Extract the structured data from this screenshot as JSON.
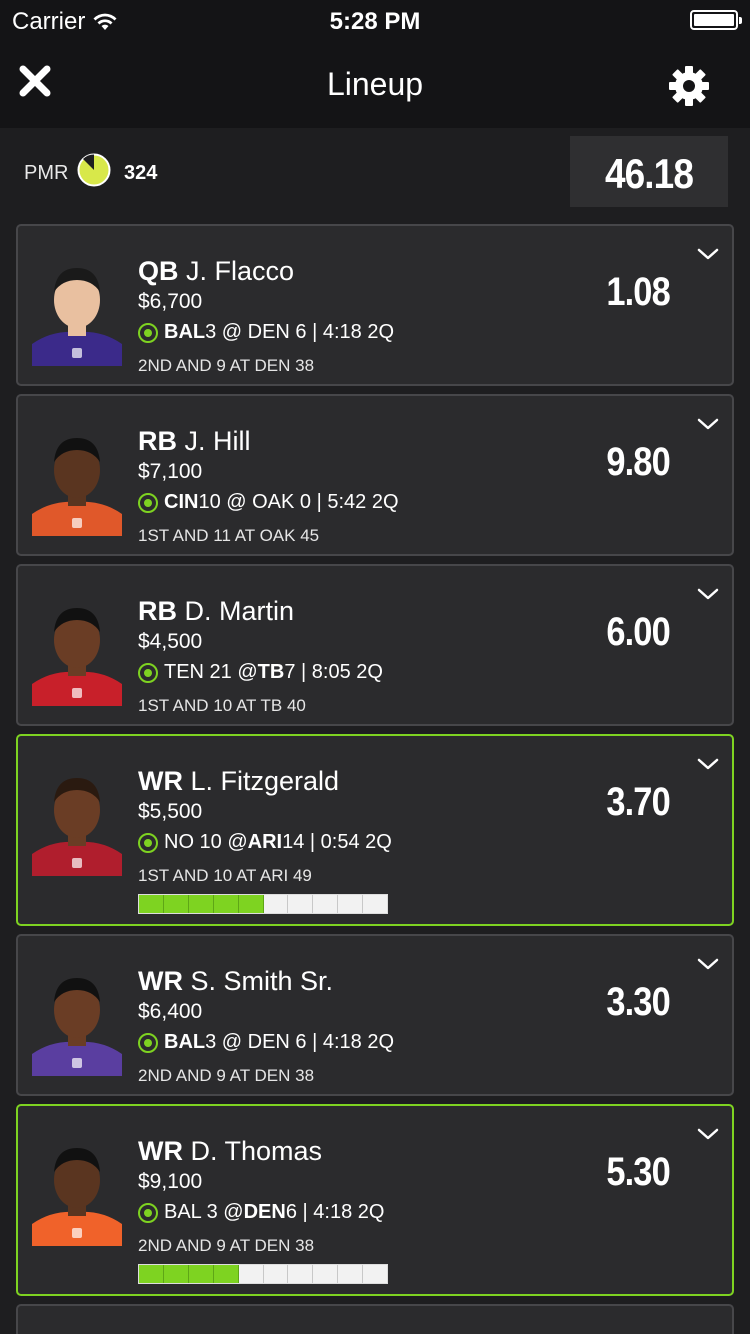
{
  "status_bar": {
    "carrier": "Carrier",
    "time": "5:28 PM"
  },
  "nav": {
    "title": "Lineup"
  },
  "summary": {
    "pmr_label": "PMR",
    "pmr_value": "324",
    "total_points": "46.18"
  },
  "colors": {
    "accent": "#7ed321",
    "background": "#1e1e20",
    "card": "#2b2b2d",
    "header": "#141416"
  },
  "players": [
    {
      "position": "QB",
      "name": "J. Flacco",
      "salary": "$6,700",
      "game_pre": "",
      "game_bold": "BAL",
      "game_mid": " 3 @ DEN 6 | 4:18 2Q",
      "situation": "2ND AND 9 AT DEN 38",
      "points": "1.08",
      "jersey": "#3b2a8a",
      "skin": "#e9c0a0",
      "hair": "#1a1a1a",
      "progress": null
    },
    {
      "position": "RB",
      "name": "J. Hill",
      "salary": "$7,100",
      "game_pre": "",
      "game_bold": "CIN",
      "game_mid": " 10 @ OAK 0 | 5:42 2Q",
      "situation": "1ST AND 11 AT OAK 45",
      "points": "9.80",
      "jersey": "#e0582a",
      "skin": "#5a3520",
      "hair": "#111111",
      "progress": null
    },
    {
      "position": "RB",
      "name": "D. Martin",
      "salary": "$4,500",
      "game_pre": "TEN 21 @ ",
      "game_bold": "TB",
      "game_mid": " 7 | 8:05 2Q",
      "situation": "1ST AND 10 AT TB 40",
      "points": "6.00",
      "jersey": "#c8202a",
      "skin": "#6a3d25",
      "hair": "#111111",
      "progress": null
    },
    {
      "position": "WR",
      "name": "L. Fitzgerald",
      "salary": "$5,500",
      "game_pre": "NO 10 @ ",
      "game_bold": "ARI",
      "game_mid": " 14 | 0:54 2Q",
      "situation": "1ST AND 10 AT ARI 49",
      "points": "3.70",
      "jersey": "#b01e2d",
      "skin": "#6a3d25",
      "hair": "#2a1a10",
      "active": true,
      "progress": {
        "filled": 5,
        "total": 10
      }
    },
    {
      "position": "WR",
      "name": "S. Smith Sr.",
      "salary": "$6,400",
      "game_pre": "",
      "game_bold": "BAL",
      "game_mid": " 3 @ DEN 6 | 4:18 2Q",
      "situation": "2ND AND 9 AT DEN 38",
      "points": "3.30",
      "jersey": "#5a3ea0",
      "skin": "#6a3d25",
      "hair": "#111111",
      "progress": null
    },
    {
      "position": "WR",
      "name": "D. Thomas",
      "salary": "$9,100",
      "game_pre": "BAL 3 @ ",
      "game_bold": "DEN",
      "game_mid": " 6 | 4:18 2Q",
      "situation": "2ND AND 9 AT DEN 38",
      "points": "5.30",
      "jersey": "#f0622a",
      "skin": "#5a3520",
      "hair": "#111111",
      "active": true,
      "progress": {
        "filled": 4,
        "total": 10
      }
    }
  ]
}
